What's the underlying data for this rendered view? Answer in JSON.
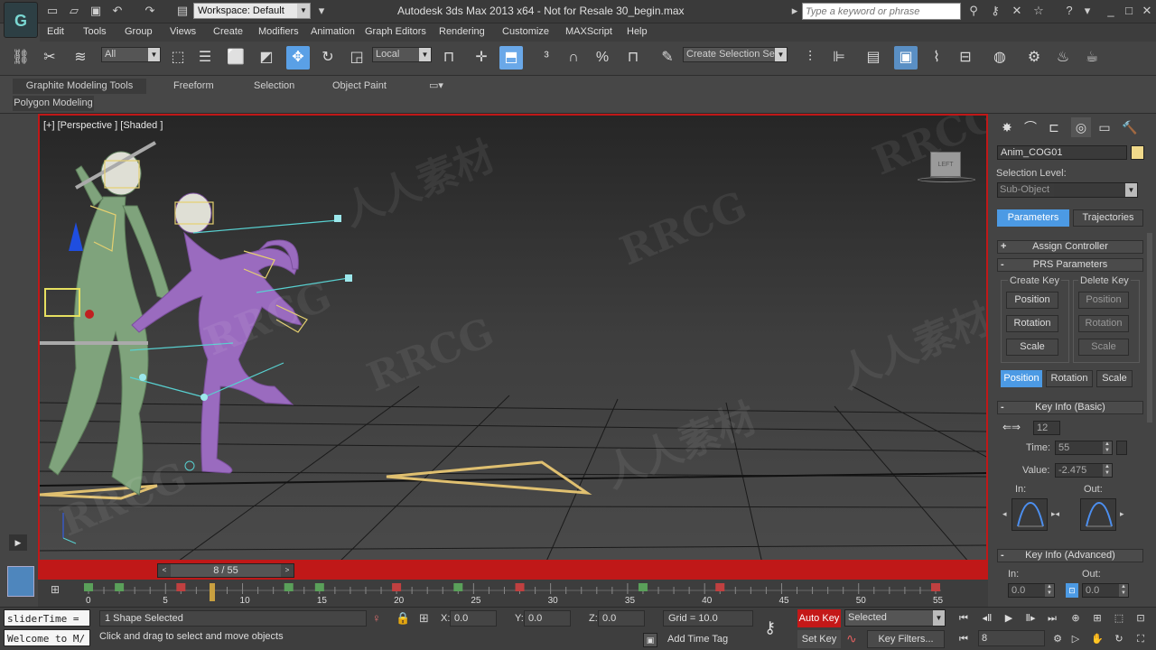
{
  "titlebar": {
    "workspace": "Workspace: Default",
    "window_title": "Autodesk 3ds Max  2013 x64  - Not for Resale   30_begin.max",
    "search_placeholder": "Type a keyword or phrase"
  },
  "menu": [
    "Edit",
    "Tools",
    "Group",
    "Views",
    "Create",
    "Modifiers",
    "Animation",
    "Graph Editors",
    "Rendering",
    "Customize",
    "MAXScript",
    "Help"
  ],
  "toolbar": {
    "selection_filter": "All",
    "ref_coord": "Local",
    "named_selection": "Create Selection Se"
  },
  "ribbon": {
    "tabs": [
      "Graphite Modeling Tools",
      "Freeform",
      "Selection",
      "Object Paint"
    ],
    "panel_label": "Polygon Modeling"
  },
  "viewport": {
    "label": "[+] [Perspective ] [Shaded ]",
    "viewcube_face": "LEFT"
  },
  "timeslider": {
    "frame_label": "8 / 55",
    "ticks": [
      "0",
      "5",
      "10",
      "15",
      "20",
      "25",
      "30",
      "35",
      "40",
      "45",
      "50",
      "55"
    ]
  },
  "cmdpanel": {
    "object_name": "Anim_COG01",
    "selection_level_label": "Selection Level:",
    "subobject_label": "Sub-Object",
    "tab_parameters": "Parameters",
    "tab_trajectories": "Trajectories",
    "rollout_assign": "Assign Controller",
    "rollout_prs": "PRS Parameters",
    "create_key_label": "Create Key",
    "delete_key_label": "Delete Key",
    "create_buttons": [
      "Position",
      "Rotation",
      "Scale"
    ],
    "delete_buttons": [
      "Position",
      "Rotation",
      "Scale"
    ],
    "bottom_tabs": [
      "Position",
      "Rotation",
      "Scale"
    ],
    "rollout_keyinfo_basic": "Key Info (Basic)",
    "key_number": "12",
    "time_label": "Time:",
    "time_value": "55",
    "value_label": "Value:",
    "value_value": "-2.475",
    "in_label": "In:",
    "out_label": "Out:",
    "rollout_keyinfo_adv": "Key Info (Advanced)",
    "adv_in_label": "In:",
    "adv_out_label": "Out:",
    "adv_in_value": "0.0",
    "adv_out_value": "0.0"
  },
  "status": {
    "maxscript_line1": "sliderTime =",
    "maxscript_line2": "Welcome to M/",
    "selection_status": "1 Shape Selected",
    "prompt": "Click and drag to select and move objects",
    "x_label": "X:",
    "x_value": "0.0",
    "y_label": "Y:",
    "y_value": "0.0",
    "z_label": "Z:",
    "z_value": "0.0",
    "grid": "Grid = 10.0",
    "add_time_tag": "Add Time Tag",
    "auto_key": "Auto Key",
    "set_key": "Set Key",
    "key_mode": "Selected",
    "key_filters": "Key Filters...",
    "current_frame": "8"
  },
  "watermarks": [
    "RRCG",
    "人人素材",
    "RRCG",
    "人人素材",
    "RRCG",
    "RRCG",
    "人人素材",
    "RRCG"
  ],
  "colors": {
    "active_viewport_border": "#c01818",
    "auto_key": "#c41818",
    "selected_button": "#4c9ae4",
    "object_color": "#f0d98a",
    "character_green": "#7fa37c",
    "character_purple": "#9a6bbf"
  }
}
